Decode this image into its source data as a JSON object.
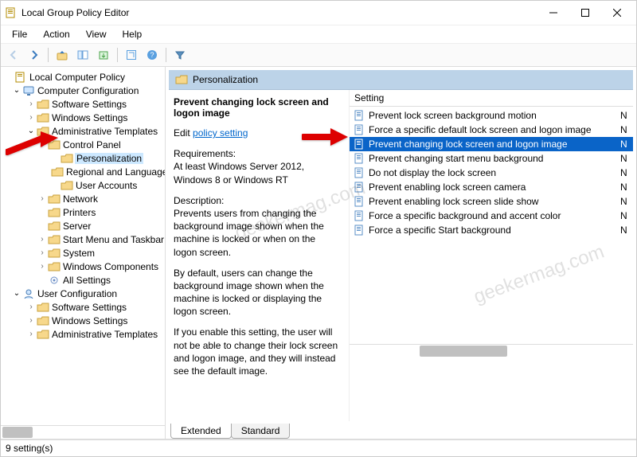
{
  "window": {
    "title": "Local Group Policy Editor"
  },
  "menubar": [
    "File",
    "Action",
    "View",
    "Help"
  ],
  "tree": {
    "root": "Local Computer Policy",
    "cc": "Computer Configuration",
    "cc_children_a": [
      "Software Settings",
      "Windows Settings"
    ],
    "at": "Administrative Templates",
    "cp": "Control Panel",
    "cp_children": [
      "Personalization",
      "Regional and Language",
      "User Accounts"
    ],
    "at_more": [
      "Network",
      "Printers",
      "Server",
      "Start Menu and Taskbar",
      "System",
      "Windows Components",
      "All Settings"
    ],
    "uc": "User Configuration",
    "uc_children": [
      "Software Settings",
      "Windows Settings",
      "Administrative Templates"
    ]
  },
  "detail": {
    "header": "Personalization",
    "title": "Prevent changing lock screen and logon image",
    "edit_prefix": "Edit ",
    "edit_link": "policy setting",
    "req_label": "Requirements:",
    "req_text": "At least Windows Server 2012, Windows 8 or Windows RT",
    "desc_label": "Description:",
    "desc_p1": "Prevents users from changing the background image shown when the machine is locked or when on the logon screen.",
    "desc_p2": "By default, users can change the background image shown when the machine is locked or displaying the logon screen.",
    "desc_p3": "If you enable this setting, the user will not be able to change their lock screen and logon image, and they will instead see the default image."
  },
  "list": {
    "col_setting": "Setting",
    "col_state_short": "N",
    "items": [
      "Prevent lock screen background motion",
      "Force a specific default lock screen and logon image",
      "Prevent changing lock screen and logon image",
      "Prevent changing start menu background",
      "Do not display the lock screen",
      "Prevent enabling lock screen camera",
      "Prevent enabling lock screen slide show",
      "Force a specific background and accent color",
      "Force a specific Start background"
    ],
    "selected_index": 2
  },
  "tabs": {
    "extended": "Extended",
    "standard": "Standard"
  },
  "status": "9 setting(s)",
  "watermark": "geekermag.com"
}
